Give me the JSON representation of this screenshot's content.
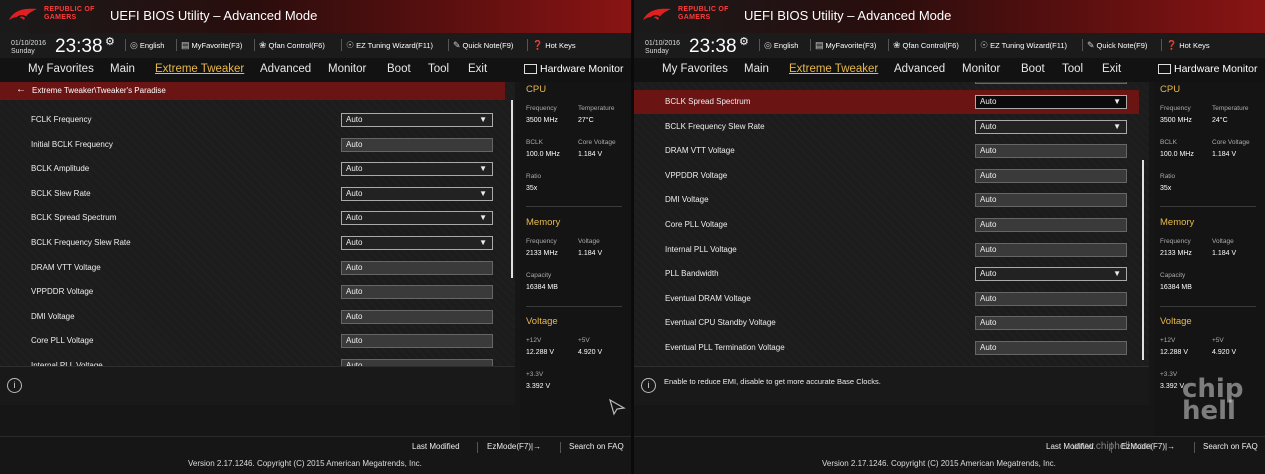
{
  "header": {
    "brand": "REPUBLIC OF GAMERS",
    "title": "UEFI BIOS Utility – Advanced Mode",
    "date": "01/10/2016",
    "day": "Sunday",
    "time": "23:38",
    "tools": [
      "English",
      "MyFavorite(F3)",
      "Qfan Control(F6)",
      "EZ Tuning Wizard(F11)",
      "Quick Note(F9)",
      "Hot Keys"
    ]
  },
  "menu": {
    "tabs": [
      "My Favorites",
      "Main",
      "Extreme Tweaker",
      "Advanced",
      "Monitor",
      "Boot",
      "Tool",
      "Exit"
    ],
    "active_tab": "Extreme Tweaker",
    "hw_title": "Hardware Monitor"
  },
  "screen1": {
    "breadcrumb": "Extreme Tweaker\\Tweaker's Paradise",
    "settings": [
      {
        "label": "FCLK Frequency",
        "value": "Auto",
        "type": "dropdown"
      },
      {
        "label": "Initial BCLK Frequency",
        "value": "Auto",
        "type": "text"
      },
      {
        "label": "BCLK Amplitude",
        "value": "Auto",
        "type": "dropdown"
      },
      {
        "label": "BCLK Slew Rate",
        "value": "Auto",
        "type": "dropdown"
      },
      {
        "label": "BCLK Spread Spectrum",
        "value": "Auto",
        "type": "dropdown"
      },
      {
        "label": "BCLK Frequency Slew Rate",
        "value": "Auto",
        "type": "dropdown"
      },
      {
        "label": "DRAM VTT Voltage",
        "value": "Auto",
        "type": "text"
      },
      {
        "label": "VPPDDR Voltage",
        "value": "Auto",
        "type": "text"
      },
      {
        "label": "DMI Voltage",
        "value": "Auto",
        "type": "text"
      },
      {
        "label": "Core PLL Voltage",
        "value": "Auto",
        "type": "text"
      },
      {
        "label": "Internal PLL Voltage",
        "value": "Auto",
        "type": "text"
      }
    ],
    "help_text": "",
    "hw": {
      "cpu_title": "CPU",
      "freq_label": "Frequency",
      "freq": "3500 MHz",
      "temp_label": "Temperature",
      "temp": "27°C",
      "bclk_label": "BCLK",
      "bclk": "100.0 MHz",
      "corev_label": "Core Voltage",
      "corev": "1.184 V",
      "ratio_label": "Ratio",
      "ratio": "35x",
      "mem_title": "Memory",
      "mem_freq_label": "Frequency",
      "mem_freq": "2133 MHz",
      "mem_volt_label": "Voltage",
      "mem_volt": "1.184 V",
      "cap_label": "Capacity",
      "cap": "16384 MB",
      "volt_title": "Voltage",
      "v12_label": "+12V",
      "v12": "12.288 V",
      "v5_label": "+5V",
      "v5": "4.920 V",
      "v33_label": "+3.3V",
      "v33": "3.392 V"
    }
  },
  "screen2": {
    "settings": [
      {
        "label": "BCLK Spread Spectrum",
        "value": "Auto",
        "type": "dropdown-selected"
      },
      {
        "label": "BCLK Frequency Slew Rate",
        "value": "Auto",
        "type": "dropdown"
      },
      {
        "label": "DRAM VTT Voltage",
        "value": "Auto",
        "type": "text"
      },
      {
        "label": "VPPDDR Voltage",
        "value": "Auto",
        "type": "text"
      },
      {
        "label": "DMI Voltage",
        "value": "Auto",
        "type": "text"
      },
      {
        "label": "Core PLL Voltage",
        "value": "Auto",
        "type": "text"
      },
      {
        "label": "Internal PLL Voltage",
        "value": "Auto",
        "type": "text"
      },
      {
        "label": "PLL Bandwidth",
        "value": "Auto",
        "type": "dropdown"
      },
      {
        "label": "Eventual DRAM Voltage",
        "value": "Auto",
        "type": "text"
      },
      {
        "label": "Eventual CPU Standby Voltage",
        "value": "Auto",
        "type": "text"
      },
      {
        "label": "Eventual PLL Termination Voltage",
        "value": "Auto",
        "type": "text"
      }
    ],
    "help_text": "Enable to reduce EMI, disable to get more accurate Base Clocks.",
    "hw": {
      "cpu_title": "CPU",
      "freq_label": "Frequency",
      "freq": "3500 MHz",
      "temp_label": "Temperature",
      "temp": "24°C",
      "bclk_label": "BCLK",
      "bclk": "100.0 MHz",
      "corev_label": "Core Voltage",
      "corev": "1.184 V",
      "ratio_label": "Ratio",
      "ratio": "35x",
      "mem_title": "Memory",
      "mem_freq_label": "Frequency",
      "mem_freq": "2133 MHz",
      "mem_volt_label": "Voltage",
      "mem_volt": "1.184 V",
      "cap_label": "Capacity",
      "cap": "16384 MB",
      "volt_title": "Voltage",
      "v12_label": "+12V",
      "v12": "12.288 V",
      "v5_label": "+5V",
      "v5": "4.920 V",
      "v33_label": "+3.3V",
      "v33": "3.392 V"
    }
  },
  "footer": {
    "last_modified": "Last Modified",
    "ezmode": "EzMode(F7)|",
    "search": "Search on FAQ",
    "version": "Version 2.17.1246. Copyright (C) 2015 American Megatrends, Inc."
  },
  "watermark": {
    "url": "www.chiphell.com",
    "logo": "chip hell"
  }
}
